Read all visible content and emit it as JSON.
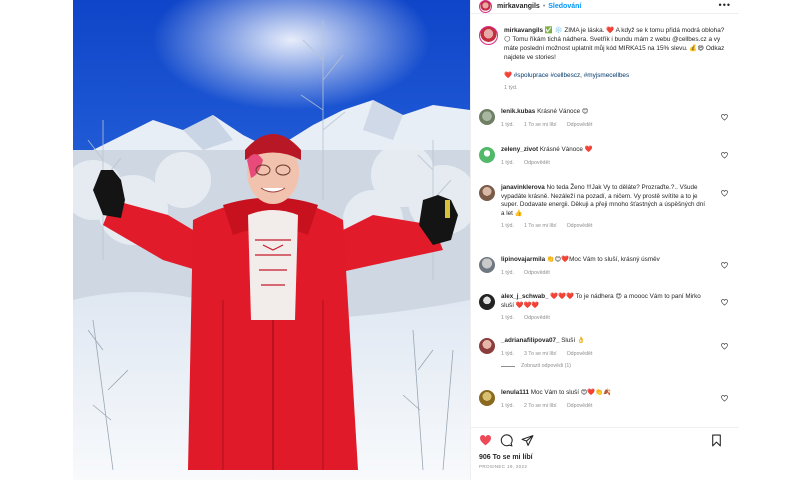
{
  "header": {
    "username": "mirkavangils",
    "follow_label": "Sledování"
  },
  "caption": {
    "username": "mirkavangils",
    "text_1": " ✅ ❄️ ZIMA je láska. ❤️ A když se k tomu přidá modrá obloha? 🌕 Tomu říkám tichá nádhera. Svetřík i bundu mám z webu @cellbes.cz a vy máte poslední možnost uplatnit můj kód MIRKA15 na 15% slevu. 💰😄 Odkaz najdete ve stories!",
    "tags": "❤️ #spoluprace #cellbescz, #myjsmecellbes",
    "time": "1 týd."
  },
  "comments": [
    {
      "user": "lenik.kubas",
      "text": "Krásné Vánoce 😊",
      "time": "1 týd.",
      "likes": "1 To se mi líbí",
      "reply": "Odpovědět"
    },
    {
      "user": "zeleny_zivot",
      "text": "Krásné Vánoce ❤️",
      "time": "1 týd.",
      "likes": "",
      "reply": "Odpovědět"
    },
    {
      "user": "janavinklerova",
      "text": "No teda Ženo !!!Jak Vy to děláte? Prozraďte.?.. Všude vypadáte krásně. Nezáleží na pozadí, a ničem. Vy prostě svítíte a to je super. Dodavate energii. Děkuji a přeji mnoho šťastných a úspěšných dní a let 👍",
      "time": "1 týd.",
      "likes": "1 To se mi líbí",
      "reply": "Odpovědět"
    },
    {
      "user": "lipinovajarmila",
      "text": "👏😊❤️Moc Vám to sluší, krásný úsměv",
      "time": "1 týd.",
      "likes": "",
      "reply": "Odpovědět"
    },
    {
      "user": "alex_j_schwab_",
      "text": "❤️❤️❤️ To je nádhera 😍 a moooc Vám to paní Mirko sluší ❤️❤️❤️",
      "time": "1 týd.",
      "likes": "",
      "reply": "Odpovědět"
    },
    {
      "user": "_adrianafilipova07_",
      "text": "Sluší 👌",
      "time": "1 týd.",
      "likes": "3 To se mi líbí",
      "reply": "Odpovědět",
      "view_replies": "Zobrazit odpovědi (1)"
    },
    {
      "user": "lenula111",
      "text": "Moc Vám to sluší 😍❤️👏🍂",
      "time": "1 týd.",
      "likes": "2 To se mi líbí",
      "reply": "Odpovědět"
    }
  ],
  "footer": {
    "likes": "906 To se mi líbí",
    "date": "PROSINEC 19, 2022"
  },
  "colors": {
    "link": "#00376b",
    "follow": "#0095f6",
    "like_red": "#ed4956",
    "muted": "#8e8e8e"
  },
  "icons": [
    "more-icon",
    "heart-filled-icon",
    "comment-icon",
    "share-icon",
    "bookmark-icon",
    "heart-outline-icon"
  ]
}
